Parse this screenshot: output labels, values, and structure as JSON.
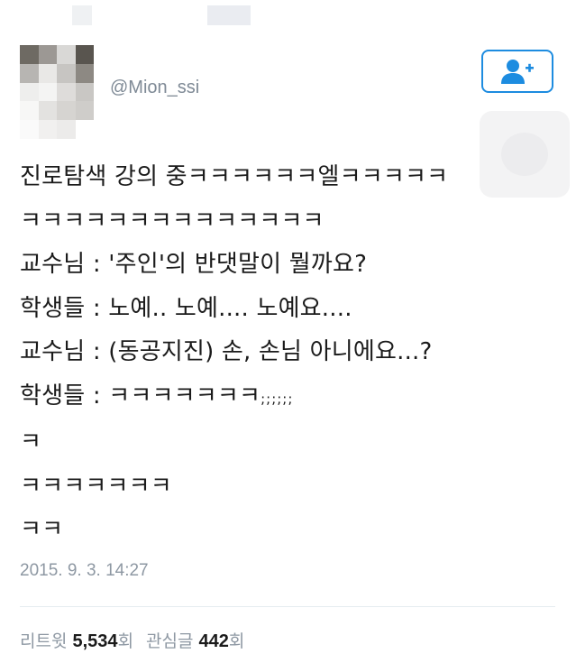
{
  "tweet": {
    "handle": "@Mion_ssi",
    "lines": [
      "진로탐색 강의 중ㅋㅋㅋㅋㅋㅋ엘ㅋㅋㅋㅋㅋ",
      "ㅋㅋㅋㅋㅋㅋㅋㅋㅋㅋㅋㅋㅋㅋ",
      "교수님 : '주인'의 반댓말이 뭘까요?",
      "학생들 : 노예.. 노예....  노예요....",
      "교수님 : (동공지진) 손, 손님 아니에요...?",
      "학생들 : ㅋㅋㅋㅋㅋㅋㅋ",
      "ㅋ",
      "ㅋㅋㅋㅋㅋㅋㅋ",
      "ㅋㅋ"
    ],
    "line6_suffix": ";;;;;;",
    "timestamp": "2015. 9. 3. 14:27"
  },
  "stats": {
    "retweet_label": "리트윗",
    "retweet_count": "5,534",
    "retweet_unit": "회",
    "like_label": "관심글",
    "like_count": "442",
    "like_unit": "회"
  },
  "follow_button": {
    "icon": "add-user-icon",
    "color": "#1d8ce0"
  },
  "colors": {
    "text": "#1b1b1b",
    "muted": "#8e98a3",
    "accent": "#1d8ce0",
    "divider": "#e6ecf0"
  }
}
